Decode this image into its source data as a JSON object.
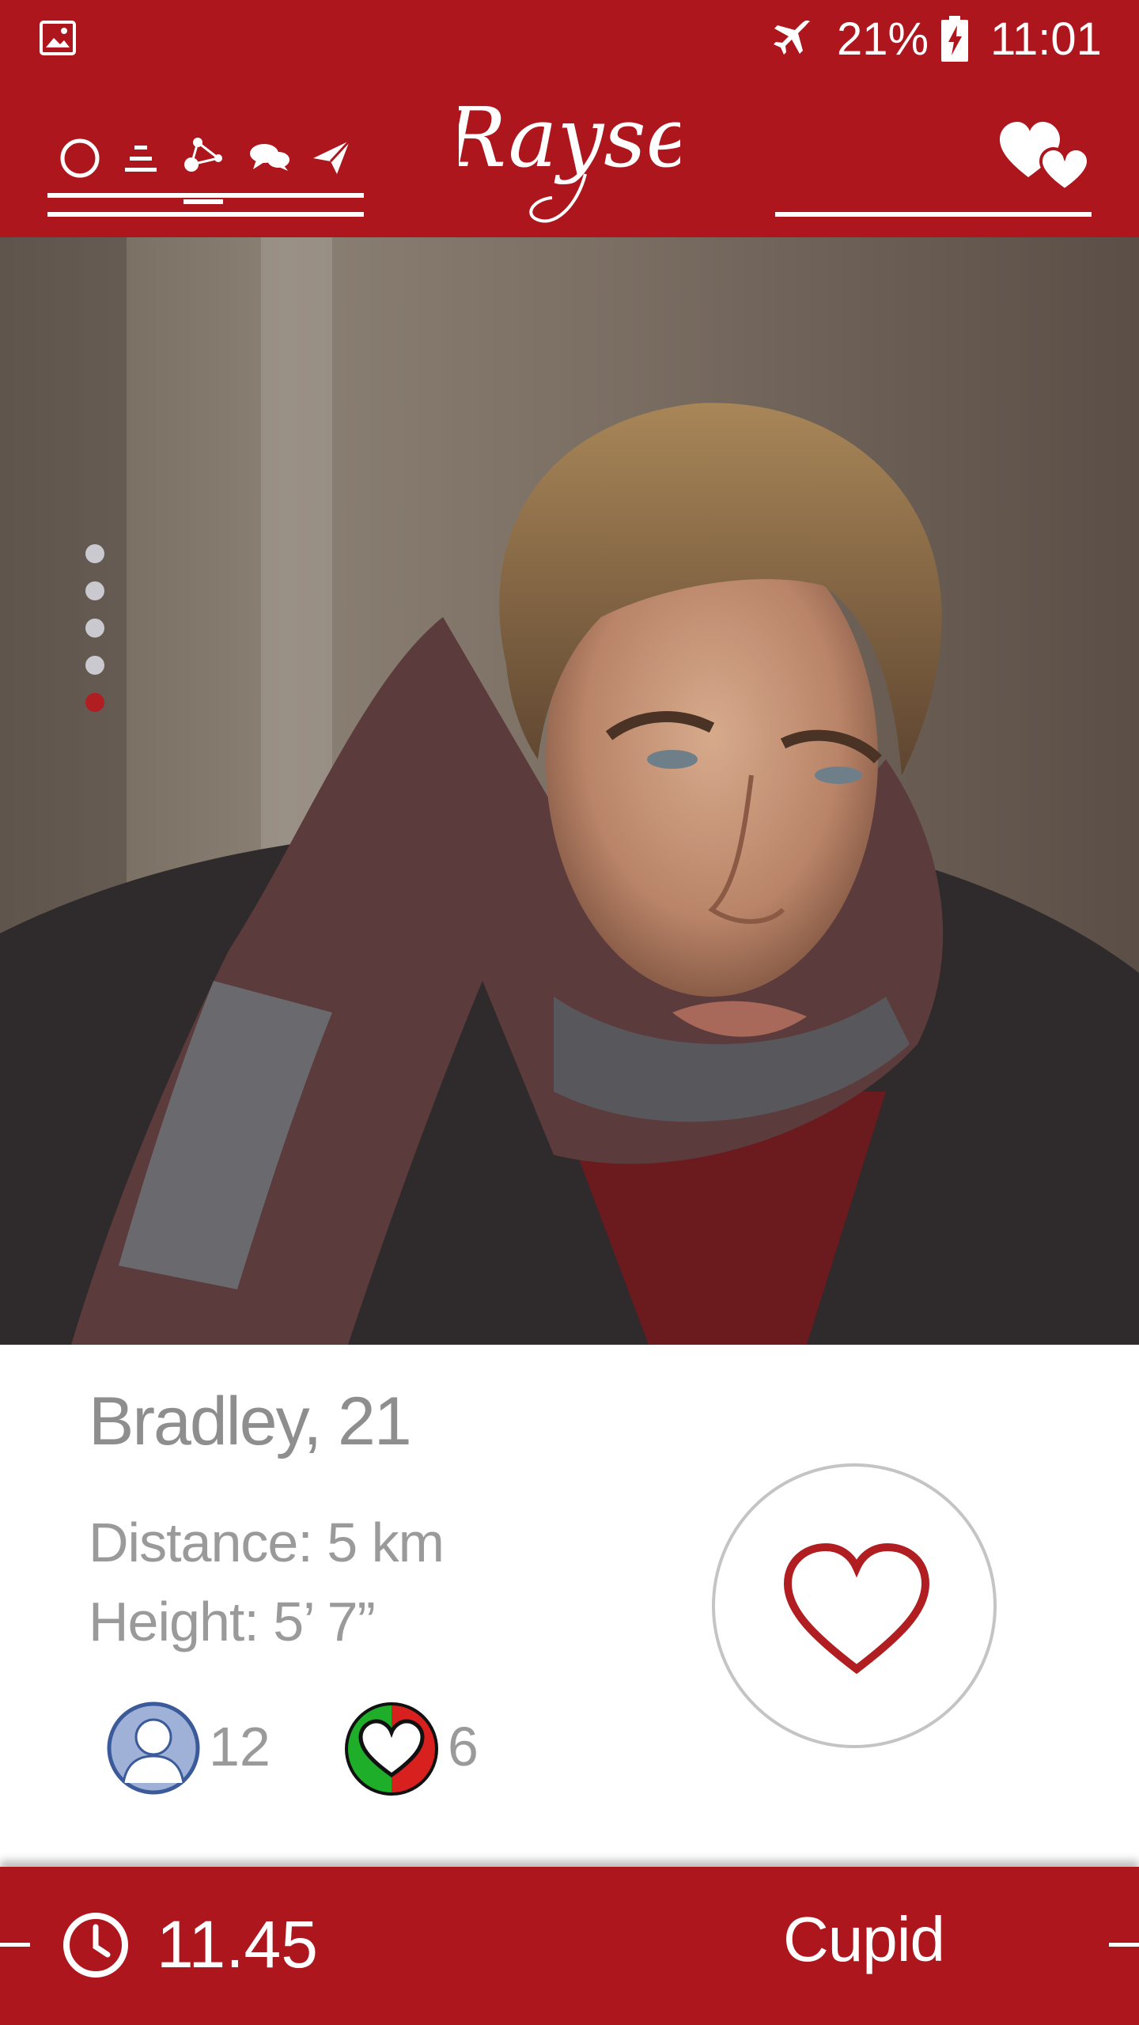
{
  "status_bar": {
    "battery": "21%",
    "time": "11:01",
    "icons": [
      "gallery-icon",
      "airplane-mode-icon",
      "battery-charging-icon"
    ]
  },
  "header": {
    "logo": "Rayse",
    "nav_icons": [
      "profile-circle-icon",
      "filters-icon",
      "network-icon",
      "chat-icon",
      "send-icon"
    ],
    "right_icon": "hearts-icon",
    "background": "#ad161c"
  },
  "gallery": {
    "photo_count": 5,
    "active_index": 4,
    "dot_color": "#c9c9cf",
    "active_dot_color": "#b01e22"
  },
  "profile": {
    "name_age": "Bradley, 21",
    "distance": "Distance: 5 km",
    "height": "Height: 5’ 7”",
    "friends_count": "12",
    "matches_count": "6"
  },
  "like_button": {
    "icon": "heart-outline-icon",
    "color": "#b01e22"
  },
  "bottom_bar": {
    "timer": "11.45",
    "timer_icon": "clock-icon",
    "mode_label": "Cupid",
    "background": "#ad161c"
  }
}
